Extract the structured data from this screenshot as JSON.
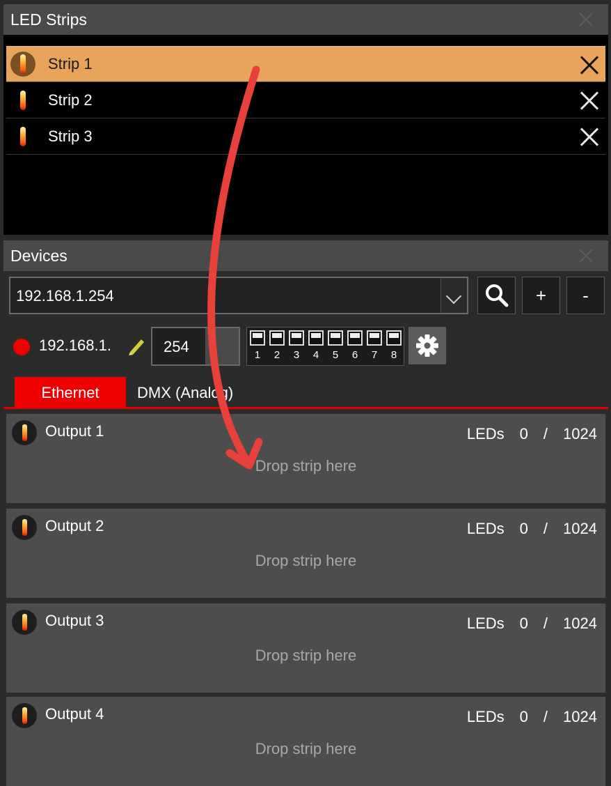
{
  "strips_panel": {
    "title": "LED Strips",
    "strips": [
      {
        "label": "Strip 1",
        "selected": true
      },
      {
        "label": "Strip 2",
        "selected": false
      },
      {
        "label": "Strip 3",
        "selected": false
      }
    ]
  },
  "devices_panel": {
    "title": "Devices",
    "ip_select_value": "192.168.1.254",
    "add_label": "+",
    "remove_label": "-",
    "status_color": "#ee0000",
    "ip_prefix": "192.168.1.",
    "last_octet": "254",
    "dip_switches": [
      {
        "num": "1",
        "on": false
      },
      {
        "num": "2",
        "on": false
      },
      {
        "num": "3",
        "on": false
      },
      {
        "num": "4",
        "on": false
      },
      {
        "num": "5",
        "on": false
      },
      {
        "num": "6",
        "on": false
      },
      {
        "num": "7",
        "on": false
      },
      {
        "num": "8",
        "on": false
      }
    ],
    "tabs": [
      {
        "label": "Ethernet",
        "active": true
      },
      {
        "label": "DMX (Analog)",
        "active": false
      }
    ],
    "outputs": [
      {
        "title": "Output 1",
        "leds_label": "LEDs",
        "count": "0",
        "sep": "/",
        "max": "1024",
        "drop_text": "Drop strip here"
      },
      {
        "title": "Output 2",
        "leds_label": "LEDs",
        "count": "0",
        "sep": "/",
        "max": "1024",
        "drop_text": "Drop strip here"
      },
      {
        "title": "Output 3",
        "leds_label": "LEDs",
        "count": "0",
        "sep": "/",
        "max": "1024",
        "drop_text": "Drop strip here"
      },
      {
        "title": "Output 4",
        "leds_label": "LEDs",
        "count": "0",
        "sep": "/",
        "max": "1024",
        "drop_text": "Drop strip here"
      }
    ]
  },
  "colors": {
    "selected_row": "#e8a45a",
    "accent_red": "#ee0000",
    "drag_arrow": "#e8403a"
  }
}
